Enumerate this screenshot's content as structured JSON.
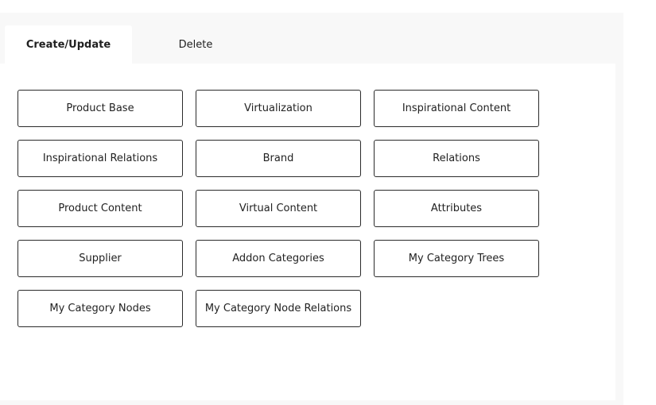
{
  "tabs": [
    {
      "label": "Create/Update",
      "active": true
    },
    {
      "label": "Delete",
      "active": false
    }
  ],
  "buttons": [
    "Product Base",
    "Virtualization",
    "Inspirational Content",
    "Inspirational Relations",
    "Brand",
    "Relations",
    "Product Content",
    "Virtual Content",
    "Attributes",
    "Supplier",
    "Addon Categories",
    "My Category Trees",
    "My Category Nodes",
    "My Category Node Relations"
  ],
  "colors": {
    "panel_background": "#f8f8f8",
    "content_background": "#ffffff",
    "button_border": "#2b2b2b"
  }
}
